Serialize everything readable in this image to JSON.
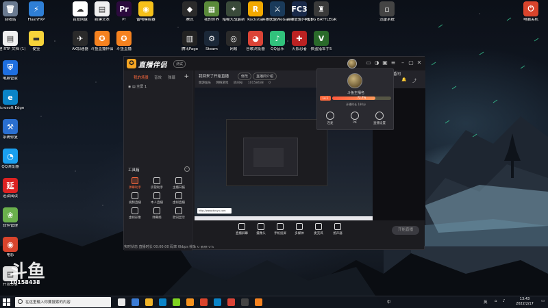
{
  "desktop": {
    "icons": [
      {
        "label": "回收站",
        "glyph": "🗑",
        "color": "#6a7a90",
        "col": 0,
        "row": 0
      },
      {
        "label": "FlashFXP",
        "glyph": "⚡",
        "color": "#2f7fd6",
        "col": 1,
        "row": 0
      },
      {
        "label": "百度网盘",
        "glyph": "☁",
        "color": "#ffffff",
        "col": 3,
        "row": 0
      },
      {
        "label": "新建文本",
        "glyph": "▤",
        "color": "#f0f0f0",
        "col": 4,
        "row": 0
      },
      {
        "label": "Pr",
        "glyph": "Pr",
        "color": "#2b0a3d",
        "col": 5,
        "row": 0
      },
      {
        "label": "雷电模拟器",
        "glyph": "◉",
        "color": "#f6c11a",
        "col": 6,
        "row": 0
      },
      {
        "label": "腾讯",
        "glyph": "◆",
        "color": "#2b2b2b",
        "col": 8,
        "row": 0
      },
      {
        "label": "我的世界",
        "glyph": "▦",
        "color": "#5a8a3a",
        "col": 9,
        "row": 0
      },
      {
        "label": "暗喻大战最新",
        "glyph": "✦",
        "color": "#3a4a3a",
        "col": 10,
        "row": 0
      },
      {
        "label": "Rockstar",
        "glyph": "R",
        "color": "#f2a900",
        "col": 11,
        "row": 0
      },
      {
        "label": "英雄联盟WeGame版",
        "glyph": "⚔",
        "color": "#1a3a5a",
        "col": 12,
        "row": 0
      },
      {
        "label": "英雄联盟(中国)",
        "glyph": "FC3",
        "color": "#1a2a4a",
        "col": 13,
        "row": 0
      },
      {
        "label": "PUBG BATTLEGR...",
        "glyph": "♜",
        "color": "#3a3a3a",
        "col": 14,
        "row": 0
      },
      {
        "label": "迅雷系统",
        "glyph": "▫",
        "color": "#444",
        "col": 17,
        "row": 0
      },
      {
        "label": "电脑关机",
        "glyph": "⏻",
        "color": "#d9442c",
        "col": 22,
        "row": 0
      },
      {
        "label": "新建 RTF 文档 (1)",
        "glyph": "▤",
        "color": "#f0f0f0",
        "col": 0,
        "row": 1
      },
      {
        "label": "便签",
        "glyph": "▬",
        "color": "#f6d33a",
        "col": 1,
        "row": 1
      },
      {
        "label": "AK加速器",
        "glyph": "✈",
        "color": "#2a2a2a",
        "col": 3,
        "row": 1
      },
      {
        "label": "斗鱼直播伴侣",
        "glyph": "✪",
        "color": "#f6821f",
        "col": 4,
        "row": 1
      },
      {
        "label": "斗鱼直播",
        "glyph": "✪",
        "color": "#f6821f",
        "col": 5,
        "row": 1
      },
      {
        "label": "腾讯Page",
        "glyph": "▥",
        "color": "#222",
        "col": 8,
        "row": 1
      },
      {
        "label": "Steam",
        "glyph": "⚙",
        "color": "#1b2838",
        "col": 9,
        "row": 1
      },
      {
        "label": "网易",
        "glyph": "◎",
        "color": "#2a2a2a",
        "col": 10,
        "row": 1
      },
      {
        "label": "谷歌浏览器",
        "glyph": "◕",
        "color": "#db4437",
        "col": 11,
        "row": 1
      },
      {
        "label": "QQ音乐",
        "glyph": "♪",
        "color": "#31c27c",
        "col": 12,
        "row": 1
      },
      {
        "label": "火影忍者",
        "glyph": "✚",
        "color": "#b22",
        "col": 13,
        "row": 1
      },
      {
        "label": "侠盗猎车手5",
        "glyph": "V",
        "color": "#2a6a2a",
        "col": 14,
        "row": 1
      },
      {
        "label": "电脑管家",
        "glyph": "⛨",
        "color": "#1e6fe0",
        "col": 0,
        "row": 2
      },
      {
        "label": "Microsoft Edge",
        "glyph": "e",
        "color": "#0a84c8",
        "col": 0,
        "row": 3
      },
      {
        "label": "系统修复",
        "glyph": "⚒",
        "color": "#2a6fd0",
        "col": 0,
        "row": 4
      },
      {
        "label": "QQ浏览器",
        "glyph": "◔",
        "color": "#1aa0f0",
        "col": 0,
        "row": 5
      },
      {
        "label": "迅读阅读",
        "glyph": "延",
        "color": "#d22",
        "col": 0,
        "row": 6
      },
      {
        "label": "软件管理",
        "glyph": "❀",
        "color": "#6ab04c",
        "col": 0,
        "row": 7
      },
      {
        "label": "电影",
        "glyph": "◉",
        "color": "#d9442c",
        "col": 0,
        "row": 8
      },
      {
        "label": "开发分享",
        "glyph": "▤",
        "color": "#ddd",
        "col": 0,
        "row": 9
      }
    ]
  },
  "app": {
    "brand": "直播伴侣",
    "version_badge": "测试",
    "tabs": [
      "我的场景",
      "音效",
      "弹幕"
    ],
    "scene_item": "全屏 1",
    "tools_title": "工具箱",
    "tools": [
      {
        "label": "弹幕助手",
        "hot": true
      },
      {
        "label": "房管助手",
        "hot": false
      },
      {
        "label": "主播日报",
        "hot": false
      },
      {
        "label": "视频直播",
        "hot": false
      },
      {
        "label": "本人直播",
        "hot": false
      },
      {
        "label": "虚拟直播",
        "hot": false
      },
      {
        "label": "虚拟形象",
        "hot": false
      },
      {
        "label": "弹幕姬",
        "hot": false
      },
      {
        "label": "歌词显示",
        "hot": false
      }
    ],
    "status_text": "实时状态  直播时长 00:00:00 码率 0kbps  帧率 0  丢帧 0%",
    "room": {
      "title": "我回来了开始直播",
      "tag1": "修改",
      "tag2": "直播间介绍",
      "category": "端游娱乐",
      "subcategory": "网络游戏",
      "room_label": "房间号",
      "room_id": "10158438",
      "followers": "0"
    },
    "popup": {
      "name": "斗鱼主播名",
      "level": "Lv.1",
      "progress_percent": 72.7,
      "progress_label": "72.7%",
      "sub": "开播时长 180分",
      "actions": [
        "连麦",
        "PK",
        "直播设置"
      ]
    },
    "room_switch": "直播间",
    "bottom_toolbar": [
      "直播屏幕",
      "摄像头",
      "手机投屏",
      "多媒体",
      "麦克风",
      "扬声器"
    ],
    "go_live": "开始直播"
  },
  "capture": {
    "url_text": "http://www.douyu.com"
  },
  "watermark": {
    "logo": "斗鱼",
    "sub": "直播间",
    "room_id": "10158438"
  },
  "taskbar": {
    "search_placeholder": "在这里输入你要搜索的内容",
    "apps": [
      {
        "color": "#e8e8e8"
      },
      {
        "color": "#3a7bd5"
      },
      {
        "color": "#f0b429"
      },
      {
        "color": "#0a84c8"
      },
      {
        "color": "#7ed321"
      },
      {
        "color": "#f7931e"
      },
      {
        "color": "#d9442c"
      },
      {
        "color": "#0a84c8"
      },
      {
        "color": "#db4437"
      },
      {
        "color": "#444"
      },
      {
        "color": "#f6821f"
      }
    ],
    "tray_lang": "中",
    "tray_label": "英",
    "time": "13:43",
    "date": "2022/2/17"
  }
}
